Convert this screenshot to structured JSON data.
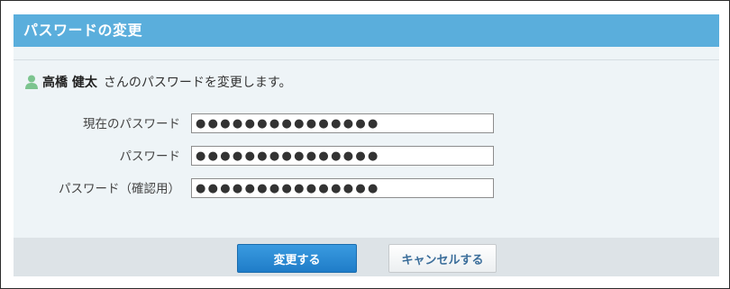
{
  "dialog": {
    "title": "パスワードの変更"
  },
  "message": {
    "user_icon": "user-icon",
    "user_name": "高橋 健太",
    "text": "さんのパスワードを変更します。"
  },
  "form": {
    "current_password": {
      "label": "現在のパスワード",
      "value": "●●●●●●●●●●●●●●●"
    },
    "new_password": {
      "label": "パスワード",
      "value": "●●●●●●●●●●●●●●●"
    },
    "confirm_password": {
      "label": "パスワード（確認用）",
      "value": "●●●●●●●●●●●●●●●"
    }
  },
  "buttons": {
    "submit_label": "変更する",
    "cancel_label": "キャンセルする"
  },
  "colors": {
    "title_bar": "#5aaedc",
    "dialog_background": "#eef4f7",
    "footer_background": "#dde3e7",
    "primary_button": "#2a8bd6",
    "user_icon": "#7cc48f"
  }
}
